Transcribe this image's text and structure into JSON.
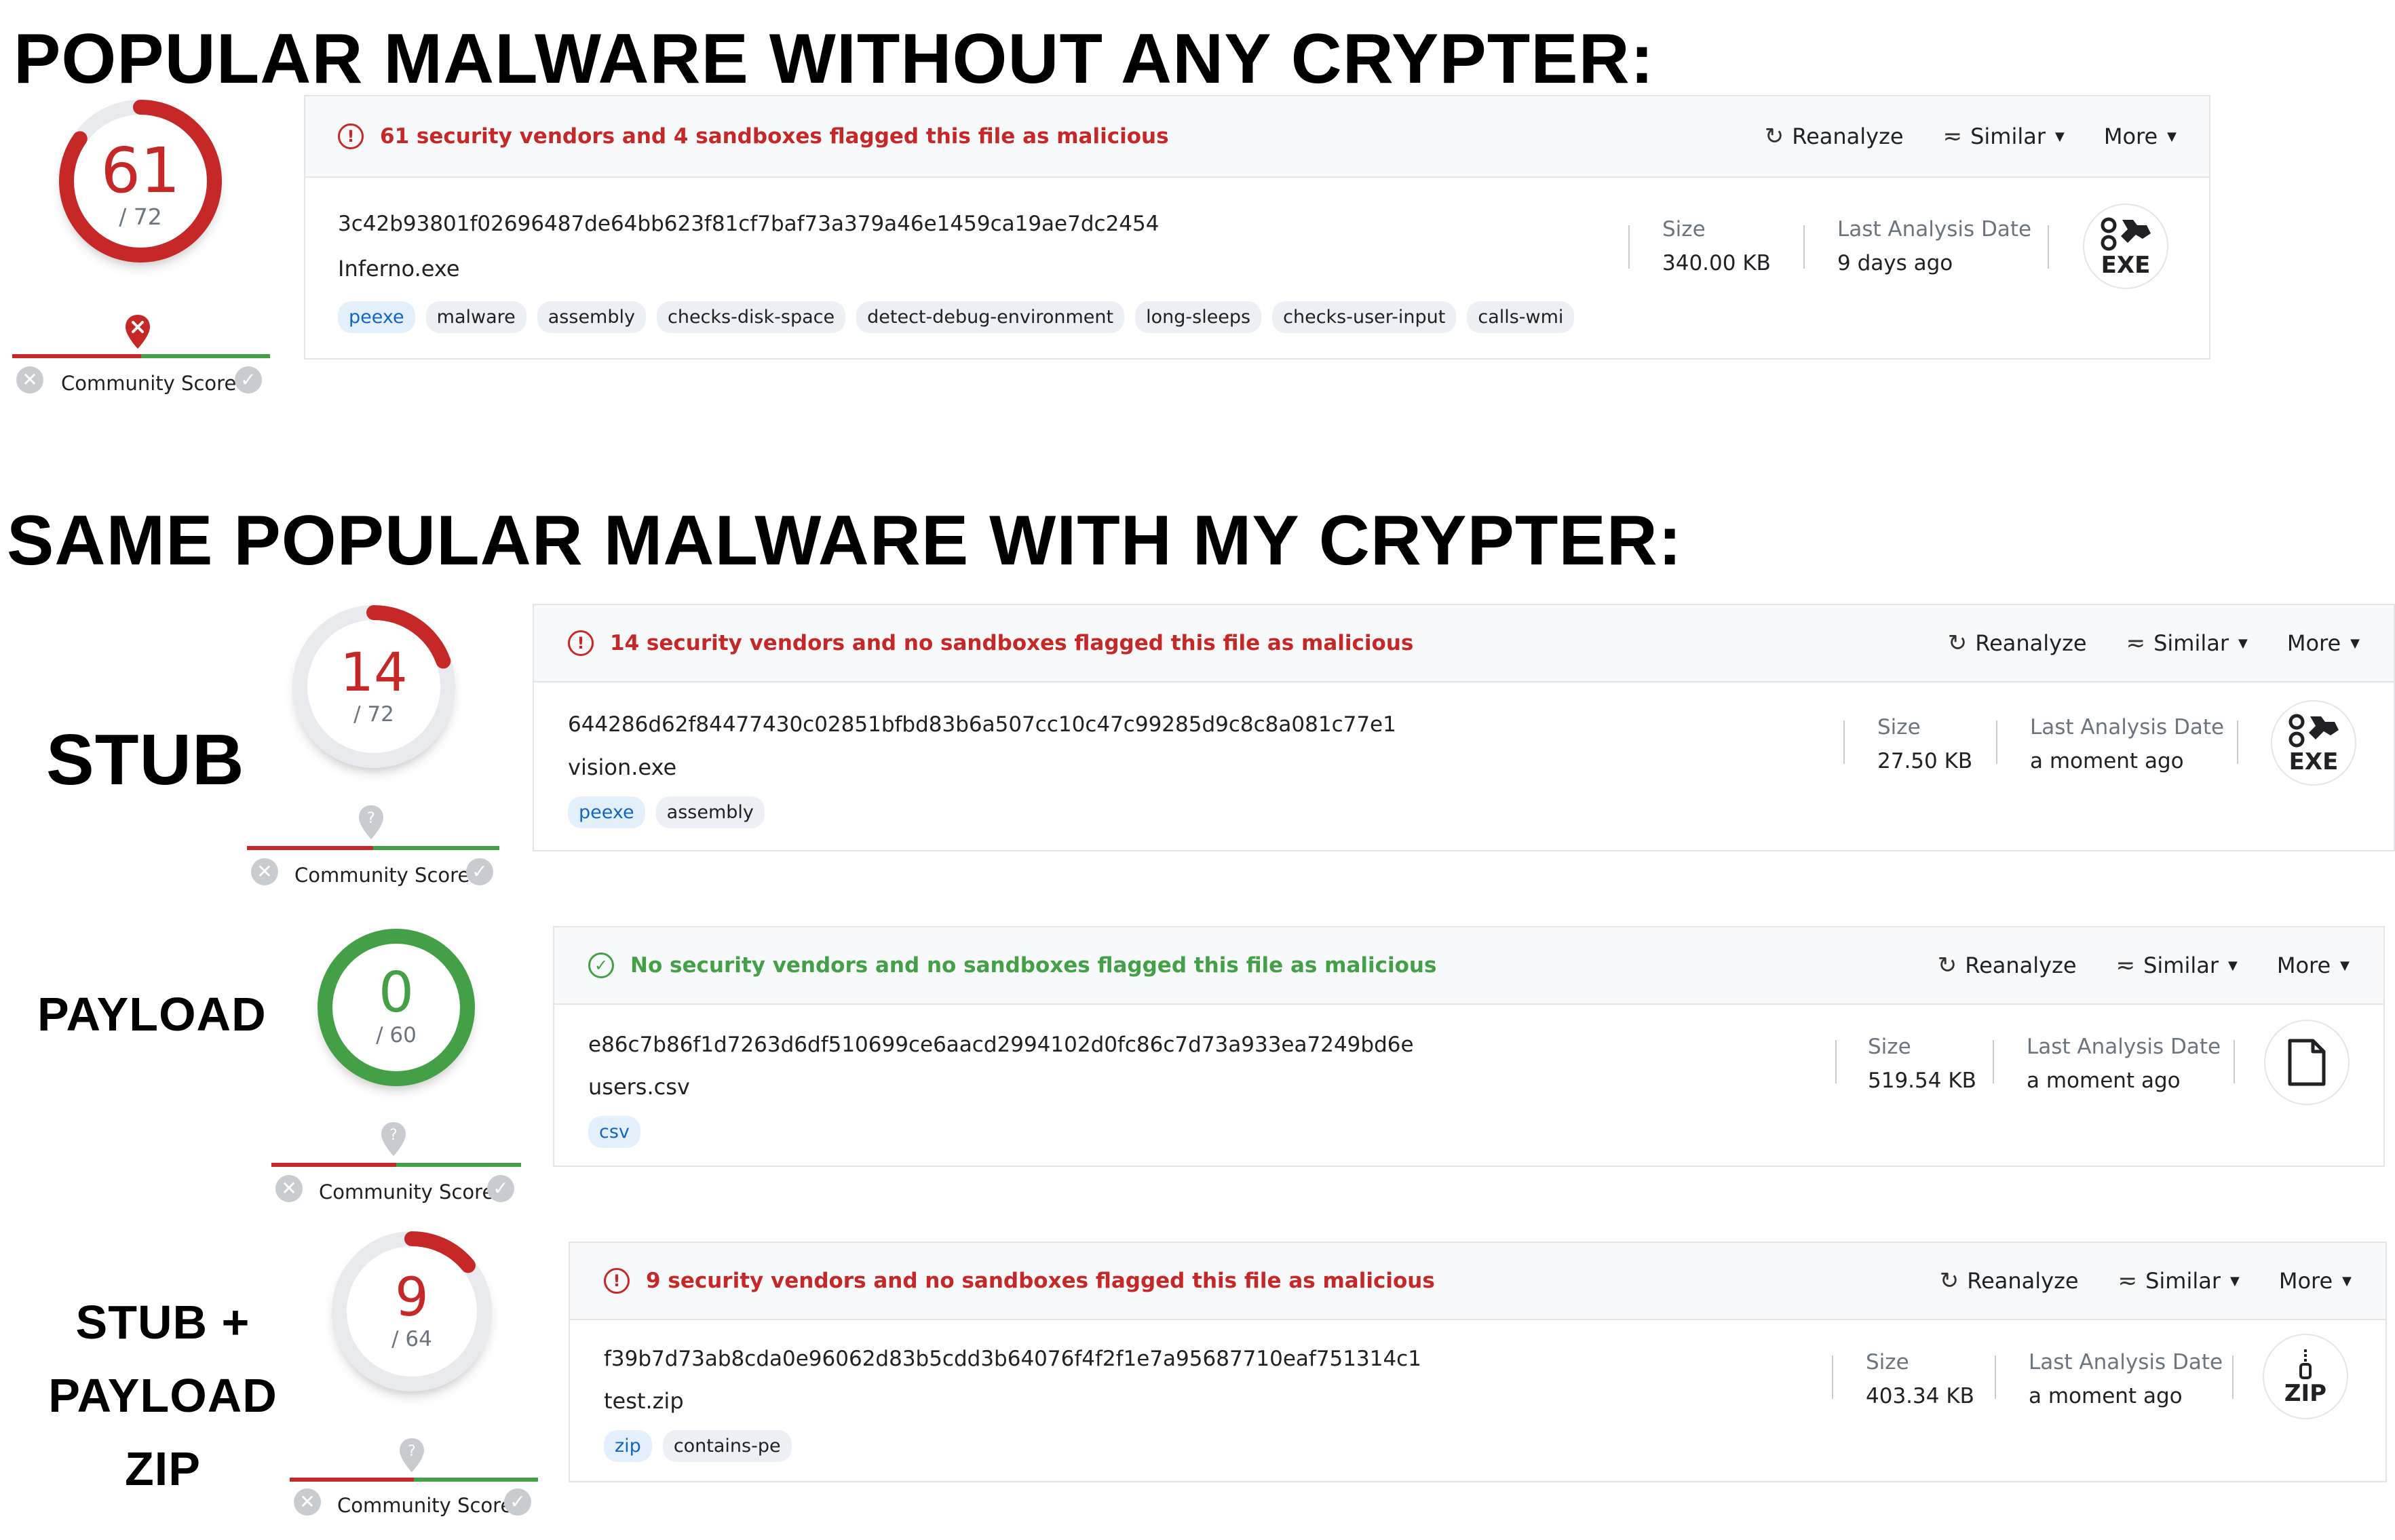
{
  "headings": {
    "top": "POPULAR MALWARE WITHOUT ANY CRYPTER:",
    "bottom": "SAME POPULAR MALWARE WITH MY CRYPTER:"
  },
  "row_labels": {
    "stub": "STUB",
    "payload": "PAYLOAD",
    "combo_line1": "STUB +",
    "combo_line2": "PAYLOAD",
    "combo_line3": "ZIP"
  },
  "colors": {
    "malicious": "#c62828",
    "clean": "#43a047",
    "gauge_track": "#e8eaed",
    "tag_primary_bg": "#e3f0fb"
  },
  "community": {
    "label": "Community Score"
  },
  "actions": {
    "reanalyze": "Reanalyze",
    "similar": "Similar",
    "more": "More"
  },
  "meta_labels": {
    "size": "Size",
    "last_analysis": "Last Analysis Date"
  },
  "scans": {
    "original": {
      "detections": "61",
      "total": "/ 72",
      "ratio": 0.847,
      "status": "malicious",
      "alert": "61 security vendors and 4 sandboxes flagged this file as malicious",
      "hash": "3c42b93801f02696487de64bb623f81cf7baf73a379a46e1459ca19ae7dc2454",
      "filename": "Inferno.exe",
      "tags": [
        "peexe",
        "malware",
        "assembly",
        "checks-disk-space",
        "detect-debug-environment",
        "long-sleeps",
        "checks-user-input",
        "calls-wmi"
      ],
      "size": "340.00 KB",
      "last_analysis": "9 days ago",
      "filetype": "EXE",
      "filetype_icon": "exe-gears-icon",
      "community_icon": "community-red-pin-icon"
    },
    "stub": {
      "detections": "14",
      "total": "/ 72",
      "ratio": 0.194,
      "status": "malicious",
      "alert": "14 security vendors and no sandboxes flagged this file as malicious",
      "hash": "644286d62f84477430c02851bfbd83b6a507cc10c47c99285d9c8c8a081c77e1",
      "filename": "vision.exe",
      "tags": [
        "peexe",
        "assembly"
      ],
      "size": "27.50 KB",
      "last_analysis": "a moment ago",
      "filetype": "EXE",
      "filetype_icon": "exe-gears-icon",
      "community_icon": "community-grey-pin-icon"
    },
    "payload": {
      "detections": "0",
      "total": "/ 60",
      "ratio": 0,
      "status": "clean",
      "alert": "No security vendors and no sandboxes flagged this file as malicious",
      "hash": "e86c7b86f1d7263d6df510699ce6aacd2994102d0fc86c7d73a933ea7249bd6e",
      "filename": "users.csv",
      "tags": [
        "csv"
      ],
      "size": "519.54 KB",
      "last_analysis": "a moment ago",
      "filetype": "",
      "filetype_icon": "document-icon",
      "community_icon": "community-grey-pin-icon"
    },
    "combo": {
      "detections": "9",
      "total": "/ 64",
      "ratio": 0.141,
      "status": "malicious",
      "alert": "9 security vendors and no sandboxes flagged this file as malicious",
      "hash": "f39b7d73ab8cda0e96062d83b5cdd3b64076f4f2f1e7a95687710eaf751314c1",
      "filename": "test.zip",
      "tags": [
        "zip",
        "contains-pe"
      ],
      "size": "403.34 KB",
      "last_analysis": "a moment ago",
      "filetype": "ZIP",
      "filetype_icon": "zip-archive-icon",
      "community_icon": "community-grey-pin-icon"
    }
  }
}
